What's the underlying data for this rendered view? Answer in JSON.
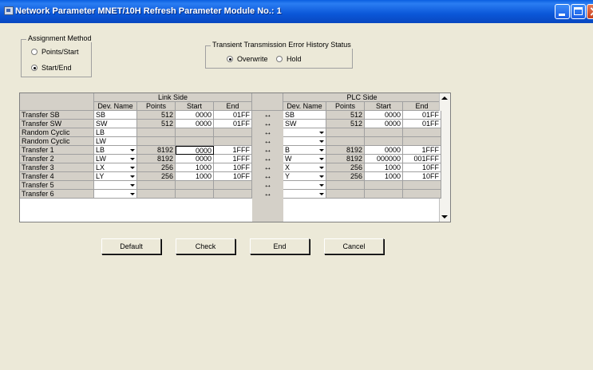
{
  "window": {
    "title": "Network Parameter  MNET/10H Refresh Parameter Module No.: 1",
    "app_icon": "app-icon",
    "controls": [
      "minimize-icon",
      "maximize-icon",
      "close-icon"
    ]
  },
  "assignment_method": {
    "label": "Assignment Method",
    "options": [
      "Points/Start",
      "Start/End"
    ],
    "selected": "Start/End"
  },
  "transient_history": {
    "label": "Transient Transmission Error History Status",
    "options": [
      "Overwrite",
      "Hold"
    ],
    "selected": "Overwrite"
  },
  "table": {
    "link_side_label": "Link Side",
    "plc_side_label": "PLC Side",
    "columns": {
      "dev_name": "Dev. Name",
      "points": "Points",
      "start": "Start",
      "end": "End"
    },
    "rows": [
      {
        "name": "Transfer SB",
        "link": [
          "SB",
          "512",
          "0000",
          "01FF"
        ],
        "plc": [
          "SB",
          "512",
          "0000",
          "01FF"
        ]
      },
      {
        "name": "Transfer SW",
        "link": [
          "SW",
          "512",
          "0000",
          "01FF"
        ],
        "plc": [
          "SW",
          "512",
          "0000",
          "01FF"
        ]
      },
      {
        "name": "Random Cyclic",
        "link": [
          "LB",
          "",
          "",
          ""
        ],
        "plc": [
          "",
          "",
          "",
          ""
        ]
      },
      {
        "name": "Random Cyclic",
        "link": [
          "LW",
          "",
          "",
          ""
        ],
        "plc": [
          "",
          "",
          "",
          ""
        ]
      },
      {
        "name": "Transfer 1",
        "link": [
          "LB",
          "8192",
          "0000",
          "1FFF"
        ],
        "plc": [
          "B",
          "8192",
          "0000",
          "1FFF"
        ]
      },
      {
        "name": "Transfer 2",
        "link": [
          "LW",
          "8192",
          "0000",
          "1FFF"
        ],
        "plc": [
          "W",
          "8192",
          "000000",
          "001FFF"
        ]
      },
      {
        "name": "Transfer 3",
        "link": [
          "LX",
          "256",
          "1000",
          "10FF"
        ],
        "plc": [
          "X",
          "256",
          "1000",
          "10FF"
        ]
      },
      {
        "name": "Transfer 4",
        "link": [
          "LY",
          "256",
          "1000",
          "10FF"
        ],
        "plc": [
          "Y",
          "256",
          "1000",
          "10FF"
        ]
      },
      {
        "name": "Transfer 5",
        "link": [
          "",
          "",
          "",
          ""
        ],
        "plc": [
          "",
          "",
          "",
          ""
        ]
      },
      {
        "name": "Transfer 6",
        "link": [
          "",
          "",
          "",
          ""
        ],
        "plc": [
          "",
          "",
          "",
          ""
        ]
      }
    ],
    "arrow_glyph": "↔"
  },
  "buttons": {
    "default": "Default",
    "check": "Check",
    "end": "End",
    "cancel": "Cancel"
  }
}
